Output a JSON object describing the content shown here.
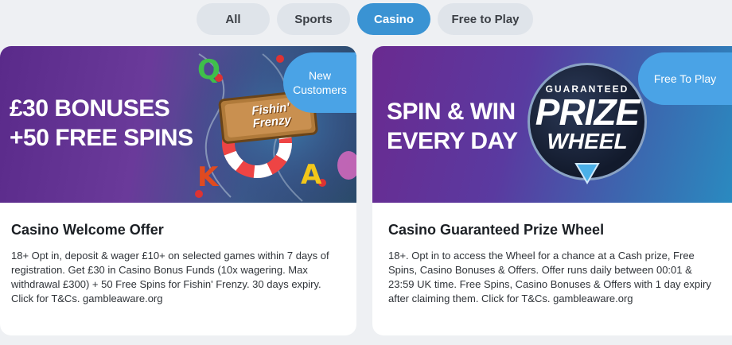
{
  "tabs": [
    {
      "label": "All",
      "active": false
    },
    {
      "label": "Sports",
      "active": false
    },
    {
      "label": "Casino",
      "active": true
    },
    {
      "label": "Free to Play",
      "active": false
    }
  ],
  "cards": [
    {
      "headline_line1": "£30 BONUSES",
      "headline_line2": "+50 FREE SPINS",
      "pill_line1": "New",
      "pill_line2": "Customers",
      "game_sign_line1": "Fishin'",
      "game_sign_line2": "Frenzy",
      "letters": [
        "Q",
        "K",
        "A"
      ],
      "title": "Casino Welcome Offer",
      "description": "18+ Opt in, deposit & wager £10+ on selected games within 7 days of registration. Get £30 in Casino Bonus Funds (10x wagering. Max withdrawal £300) + 50 Free Spins for Fishin' Frenzy. 30 days expiry. Click for T&Cs. gambleaware.org"
    },
    {
      "headline_line1": "SPIN & WIN",
      "headline_line2": "EVERY DAY",
      "pill": "Free To Play",
      "wheel_top": "GUARANTEED",
      "wheel_mid": "PRIZE",
      "wheel_bottom": "WHEEL",
      "title": "Casino Guaranteed Prize Wheel",
      "description": "18+. Opt in to access the Wheel for a chance at a Cash prize, Free Spins, Casino Bonuses & Offers. Offer runs daily between 00:01 & 23:59 UK time. Free Spins, Casino Bonuses & Offers with 1 day expiry after claiming them. Click for T&Cs. gambleaware.org"
    }
  ],
  "colors": {
    "accent": "#3a93d3",
    "tab_bg": "#dfe4ea",
    "pill": "#4aa3e6",
    "page_bg": "#eef0f3"
  }
}
